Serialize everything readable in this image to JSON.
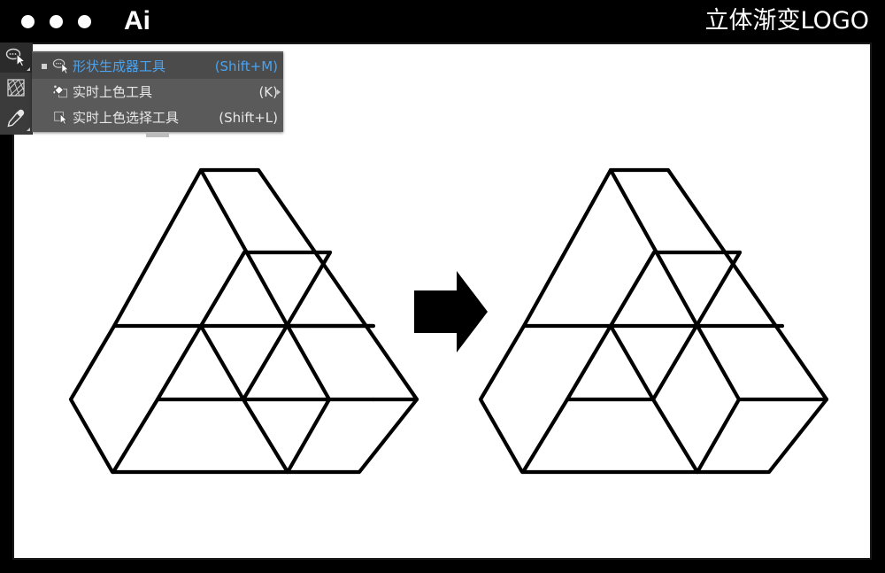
{
  "titlebar": {
    "app_logo": "Ai",
    "document_title": "立体渐变LOGO",
    "window_dots": [
      "close-dot",
      "minimize-dot",
      "zoom-dot"
    ]
  },
  "toolstrip": {
    "tools": [
      {
        "name": "shape-builder-tool",
        "icon": "shape-builder-icon",
        "active": true
      },
      {
        "name": "live-paint-bucket-tool",
        "icon": "live-paint-mesh-icon",
        "active": false
      },
      {
        "name": "eyedropper-tool",
        "icon": "eyedropper-icon",
        "active": false
      }
    ]
  },
  "flyout": {
    "items": [
      {
        "label": "形状生成器工具",
        "shortcut": "(Shift+M)",
        "icon": "shape-builder-icon",
        "selected": true
      },
      {
        "label": "实时上色工具",
        "shortcut": "(K)",
        "icon": "live-paint-bucket-icon",
        "selected": false
      },
      {
        "label": "实时上色选择工具",
        "shortcut": "(Shift+L)",
        "icon": "live-paint-selection-icon",
        "selected": false
      }
    ],
    "highlight_color": "#4aa3f0",
    "background_color": "#5a5a5a"
  },
  "canvas": {
    "background_color": "#ffffff",
    "border_color": "#1a1a1a",
    "stroke_color": "#000000",
    "arrow": {
      "name": "right-arrow",
      "color": "#000000"
    },
    "figures": [
      {
        "name": "left-figure-triangle-grid",
        "caption": "",
        "description": "triangular grid logo before shape builder merge"
      },
      {
        "name": "right-figure-rhombus-grid",
        "caption": "",
        "description": "rhombus / isometric logo after shape builder merge"
      }
    ]
  }
}
